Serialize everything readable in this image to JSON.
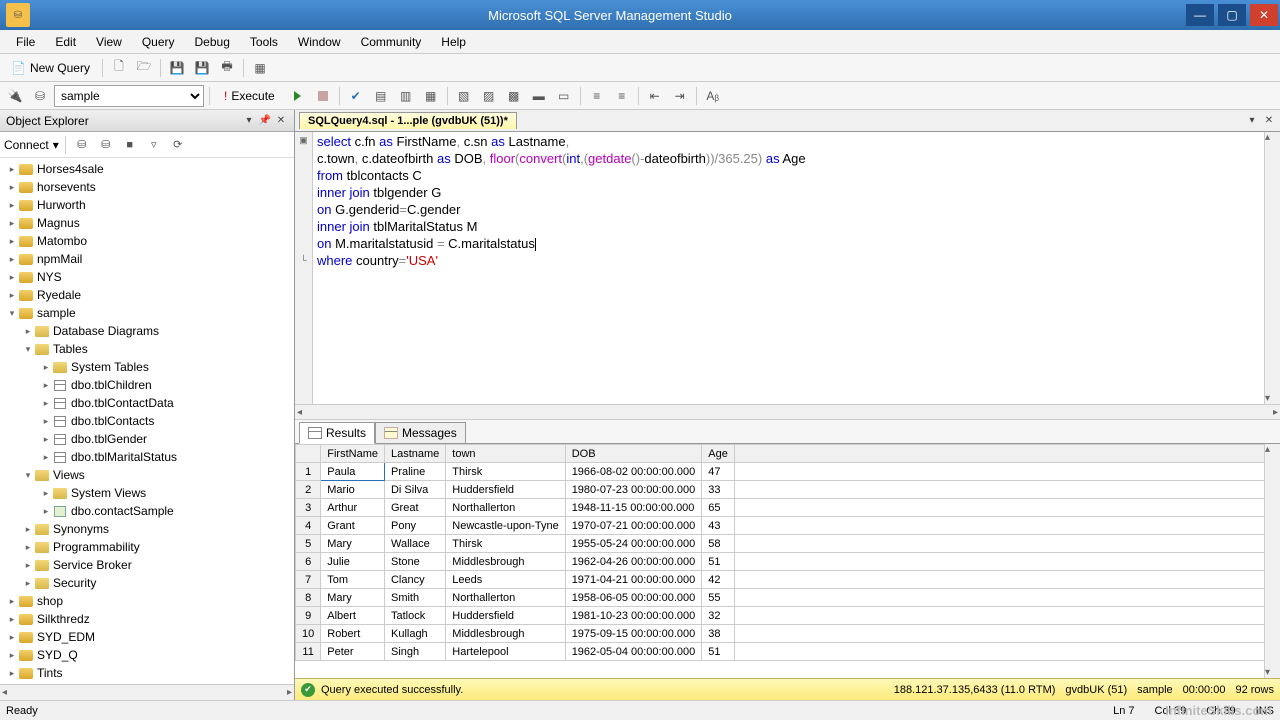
{
  "window": {
    "title": "Microsoft SQL Server Management Studio"
  },
  "menu": [
    "File",
    "Edit",
    "View",
    "Query",
    "Debug",
    "Tools",
    "Window",
    "Community",
    "Help"
  ],
  "toolbar": {
    "newquery": "New Query"
  },
  "dbselect": "sample",
  "execute": "Execute",
  "objexp": {
    "title": "Object Explorer",
    "connect": "Connect",
    "databases": [
      "Horses4sale",
      "horsevents",
      "Hurworth",
      "Magnus",
      "Matombo",
      "npmMail",
      "NYS",
      "Ryedale",
      "sample"
    ],
    "sample_folders": {
      "dbdiag": "Database Diagrams",
      "tables": "Tables",
      "systables": "System Tables",
      "t1": "dbo.tblChildren",
      "t2": "dbo.tblContactData",
      "t3": "dbo.tblContacts",
      "t4": "dbo.tblGender",
      "t5": "dbo.tblMaritalStatus",
      "views": "Views",
      "sysviews": "System Views",
      "v1": "dbo.contactSample",
      "synonyms": "Synonyms",
      "prog": "Programmability",
      "sbroker": "Service Broker",
      "security": "Security"
    },
    "more_dbs": [
      "shop",
      "Silkthredz",
      "SYD_EDM",
      "SYD_Q",
      "Tints"
    ]
  },
  "doctab": "SQLQuery4.sql - 1...ple (gvdbUK (51))*",
  "sql": {
    "l1a": "select",
    "l1b": " c.fn ",
    "l1c": "as",
    "l1d": " FirstName",
    "l1e": ", ",
    "l1f": "c.sn ",
    "l1g": "as",
    "l1h": " Lastname",
    "l2a": "c.town",
    "l2b": ", ",
    "l2c": "c.dateofbirth ",
    "l2d": "as",
    "l2e": " DOB",
    "l2f": ", ",
    "l2g": "floor",
    "l2h": "(",
    "l2i": "convert",
    "l2j": "(",
    "l2k": "int",
    "l2l": ",(",
    "l2m": "getdate",
    "l2n": "()-",
    "l2o": "dateofbirth",
    "l2p": "))/365.25) ",
    "l2q": "as",
    "l2r": " Age",
    "l3a": "from",
    "l3b": " tblcontacts C",
    "l4a": "inner join",
    "l4b": " tblgender G",
    "l5a": "on",
    "l5b": " G.genderid",
    "l5c": "=",
    "l5d": "C.gender",
    "l6a": "inner join",
    "l6b": " tblMaritalStatus M",
    "l7a": "on",
    "l7b": " M.maritalstatusid ",
    "l7c": "=",
    "l7d": " C.maritalstatus",
    "l8a": "where",
    "l8b": " country",
    "l8c": "=",
    "l8d": "'USA'"
  },
  "result_tabs": {
    "results": "Results",
    "messages": "Messages"
  },
  "grid": {
    "headers": [
      "FirstName",
      "Lastname",
      "town",
      "DOB",
      "Age"
    ],
    "rows": [
      [
        "1",
        "Paula",
        "Praline",
        "Thirsk",
        "1966-08-02 00:00:00.000",
        "47"
      ],
      [
        "2",
        "Mario",
        "Di Silva",
        "Huddersfield",
        "1980-07-23 00:00:00.000",
        "33"
      ],
      [
        "3",
        "Arthur",
        "Great",
        "Northallerton",
        "1948-11-15 00:00:00.000",
        "65"
      ],
      [
        "4",
        "Grant",
        "Pony",
        "Newcastle-upon-Tyne",
        "1970-07-21 00:00:00.000",
        "43"
      ],
      [
        "5",
        "Mary",
        "Wallace",
        "Thirsk",
        "1955-05-24 00:00:00.000",
        "58"
      ],
      [
        "6",
        "Julie",
        "Stone",
        "Middlesbrough",
        "1962-04-26 00:00:00.000",
        "51"
      ],
      [
        "7",
        "Tom",
        "Clancy",
        "Leeds",
        "1971-04-21 00:00:00.000",
        "42"
      ],
      [
        "8",
        "Mary",
        "Smith",
        "Northallerton",
        "1958-06-05 00:00:00.000",
        "55"
      ],
      [
        "9",
        "Albert",
        "Tatlock",
        "Huddersfield",
        "1981-10-23 00:00:00.000",
        "32"
      ],
      [
        "10",
        "Robert",
        "Kullagh",
        "Middlesbrough",
        "1975-09-15 00:00:00.000",
        "38"
      ],
      [
        "11",
        "Peter",
        "Singh",
        "Hartelepool",
        "1962-05-04 00:00:00.000",
        "51"
      ]
    ]
  },
  "querystatus": {
    "msg": "Query executed successfully.",
    "server": "188.121.37.135,6433 (11.0 RTM)",
    "user": "gvdbUK (51)",
    "db": "sample",
    "time": "00:00:00",
    "rows": "92 rows"
  },
  "status": {
    "ready": "Ready",
    "ln": "Ln 7",
    "col": "Col 39",
    "ch": "Ch 39",
    "ins": "INS"
  },
  "watermark": "InfiniteSkills.com"
}
